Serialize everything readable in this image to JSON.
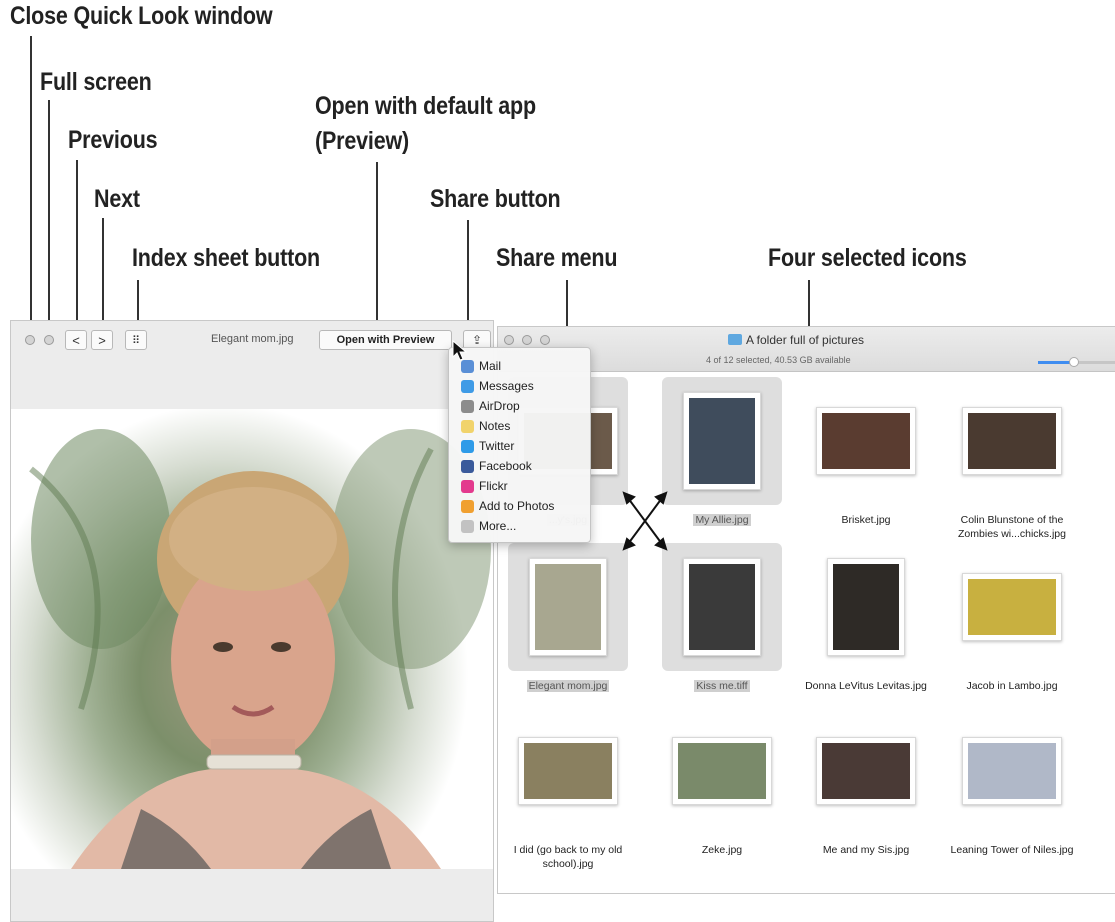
{
  "callouts": {
    "close": "Close Quick Look window",
    "fullscreen": "Full screen",
    "previous": "Previous",
    "next": "Next",
    "index_sheet": "Index sheet button",
    "open_default_line1": "Open with default app",
    "open_default_line2": "(Preview)",
    "share_button": "Share button",
    "share_menu": "Share menu",
    "four_selected": "Four selected icons"
  },
  "quicklook": {
    "filename": "Elegant mom.jpg",
    "open_with_label": "Open with Preview",
    "prev_glyph": "<",
    "next_glyph": ">",
    "index_glyph": "⠿",
    "share_glyph": "⇪"
  },
  "share_menu": {
    "items": [
      {
        "label": "Mail",
        "icon": "mail-icon",
        "color": "#5a8fd6"
      },
      {
        "label": "Messages",
        "icon": "messages-icon",
        "color": "#3f9be6"
      },
      {
        "label": "AirDrop",
        "icon": "airdrop-icon",
        "color": "#8c8c8c"
      },
      {
        "label": "Notes",
        "icon": "notes-icon",
        "color": "#f1d36b"
      },
      {
        "label": "Twitter",
        "icon": "twitter-icon",
        "color": "#2f9be8"
      },
      {
        "label": "Facebook",
        "icon": "facebook-icon",
        "color": "#3a5a9b"
      },
      {
        "label": "Flickr",
        "icon": "flickr-icon",
        "color": "#e33a8d"
      },
      {
        "label": "Add to Photos",
        "icon": "photos-icon",
        "color": "#f0a030"
      },
      {
        "label": "More...",
        "icon": "more-icon",
        "color": "#c2c2c2"
      }
    ]
  },
  "finder": {
    "title": "A folder full of pictures",
    "status": "4 of 12 selected, 40.53 GB available",
    "icon_size_fraction": 0.45,
    "files": [
      {
        "name": "...y's.jpg",
        "selected": true,
        "color": "#6b5a4a"
      },
      {
        "name": "My Allie.jpg",
        "selected": true,
        "color": "#3f4c5c"
      },
      {
        "name": "Brisket.jpg",
        "selected": false,
        "color": "#5a3c30"
      },
      {
        "name": "Colin Blunstone of the Zombies wi...chicks.jpg",
        "selected": false,
        "color": "#4a3a30"
      },
      {
        "name": "Elegant mom.jpg",
        "selected": true,
        "color": "#a8a790"
      },
      {
        "name": "Kiss me.tiff",
        "selected": true,
        "color": "#3a3a3a"
      },
      {
        "name": "Donna LeVitus Levitas.jpg",
        "selected": false,
        "color": "#2e2a26"
      },
      {
        "name": "Jacob in Lambo.jpg",
        "selected": false,
        "color": "#c8b040"
      },
      {
        "name": "I did (go back to my old school).jpg",
        "selected": false,
        "color": "#8a8060"
      },
      {
        "name": "Zeke.jpg",
        "selected": false,
        "color": "#7a8a6a"
      },
      {
        "name": "Me and my Sis.jpg",
        "selected": false,
        "color": "#4a3a36"
      },
      {
        "name": "Leaning Tower of Niles.jpg",
        "selected": false,
        "color": "#b0b8c8"
      }
    ]
  }
}
